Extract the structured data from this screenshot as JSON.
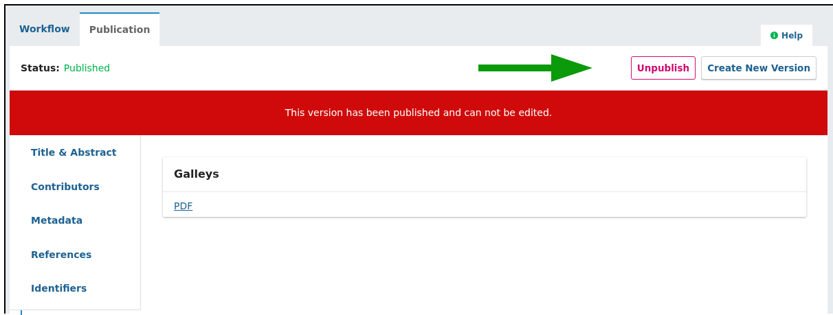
{
  "tabs": [
    {
      "label": "Workflow",
      "selected": false
    },
    {
      "label": "Publication",
      "selected": true
    }
  ],
  "help": {
    "label": "Help"
  },
  "status": {
    "label": "Status:",
    "value": "Published"
  },
  "buttons": [
    {
      "label": "Unpublish",
      "kind": "danger"
    },
    {
      "label": "Create New Version",
      "kind": "default"
    }
  ],
  "notice": "This version has been published and can not be edited.",
  "sidebar": {
    "items": [
      {
        "label": "Title & Abstract"
      },
      {
        "label": "Contributors"
      },
      {
        "label": "Metadata"
      },
      {
        "label": "References"
      },
      {
        "label": "Identifiers"
      }
    ]
  },
  "galleys": {
    "title": "Galleys",
    "links": [
      "PDF"
    ]
  }
}
